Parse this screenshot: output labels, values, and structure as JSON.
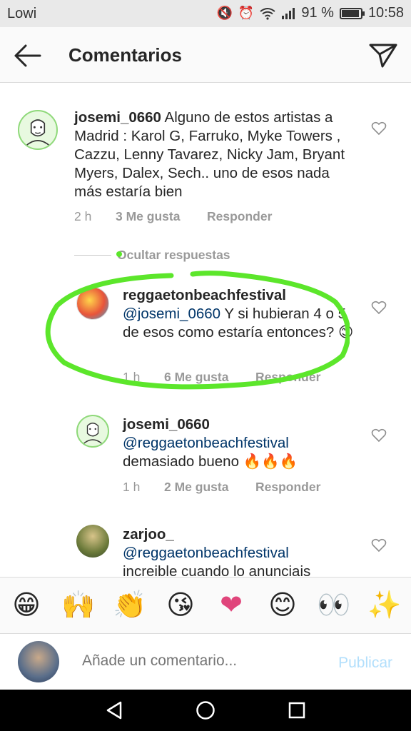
{
  "status_bar": {
    "carrier": "Lowi",
    "battery_pct": "91 %",
    "time": "10:58"
  },
  "header": {
    "title": "Comentarios",
    "back_icon": "arrow-left-icon",
    "send_icon": "paper-plane-icon"
  },
  "comments": [
    {
      "username": "josemi_0660",
      "text": "Alguno de estos artistas a Madrid : Karol G, Farruko, Myke Towers , Cazzu, Lenny Tavarez, Nicky Jam, Bryant Myers, Dalex, Sech.. uno de esos nada más estaría bien",
      "time": "2 h",
      "likes": "3 Me gusta",
      "reply": "Responder"
    }
  ],
  "hide_replies": "Ocultar respuestas",
  "replies": [
    {
      "username": "reggaetonbeachfestival",
      "mention": "@josemi_0660",
      "text": "Y si hubieran 4 o 5 de esos como estaría entonces? 😊",
      "time": "1 h",
      "likes": "6 Me gusta",
      "reply": "Responder"
    },
    {
      "username": "josemi_0660",
      "mention": "@reggaetonbeachfestival",
      "text": "demasiado bueno 🔥🔥🔥",
      "time": "1 h",
      "likes": "2 Me gusta",
      "reply": "Responder"
    },
    {
      "username": "zarjoo_",
      "mention": "@reggaetonbeachfestival",
      "text": "increible cuando lo anunciais"
    }
  ],
  "emoji_bar": [
    "😁",
    "🙌",
    "👏",
    "😘",
    "❤",
    "😊",
    "👀",
    "✨"
  ],
  "composer": {
    "placeholder": "Añade un comentario...",
    "post_label": "Publicar"
  },
  "colors": {
    "annotation_green": "#5ce62b",
    "link_blue": "#003569",
    "post_blue": "#b2dffc"
  }
}
